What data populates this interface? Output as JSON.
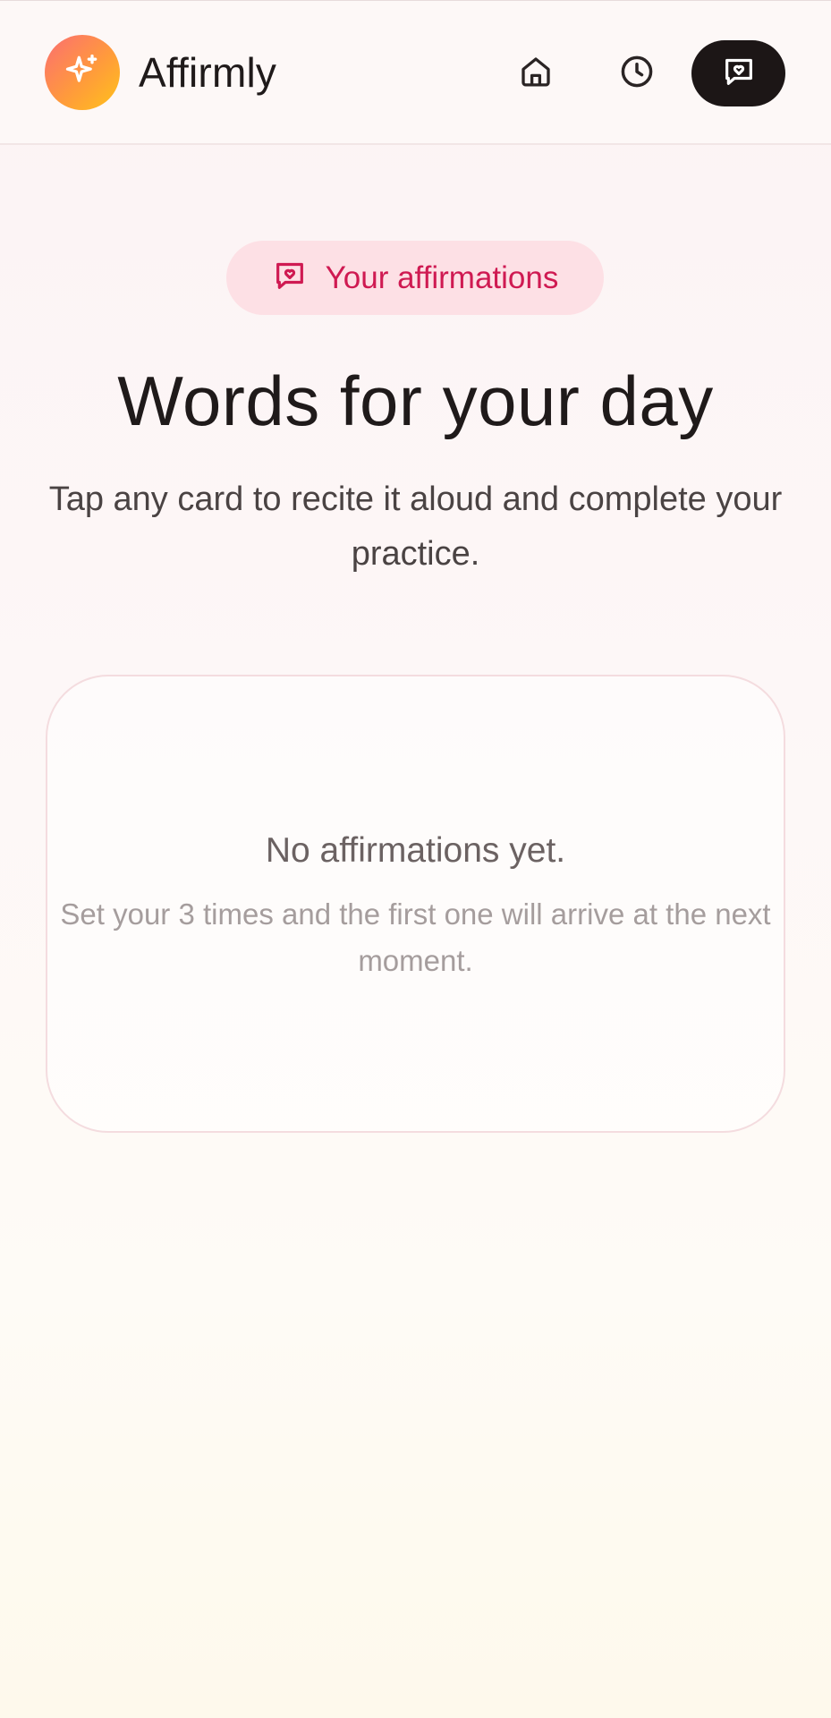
{
  "header": {
    "app_name": "Affirmly",
    "logo_icon": "sparkles-icon",
    "nav": [
      {
        "name": "home",
        "icon": "home-icon"
      },
      {
        "name": "history",
        "icon": "clock-icon"
      },
      {
        "name": "affirmations",
        "icon": "message-heart-icon",
        "active": true
      }
    ]
  },
  "badge": {
    "icon": "message-heart-icon",
    "label": "Your affirmations"
  },
  "headline": "Words for your day",
  "subtitle": "Tap any card to recite it aloud and complete your practice.",
  "empty_state": {
    "title": "No affirmations yet.",
    "description": "Set your 3 times and the first one will arrive at the next moment."
  },
  "colors": {
    "accent": "#cf1a52",
    "badge_bg": "#fde0e5",
    "active_nav_bg": "#1c1616",
    "logo_gradient_start": "#fb6e72",
    "logo_gradient_end": "#ffc21a"
  }
}
